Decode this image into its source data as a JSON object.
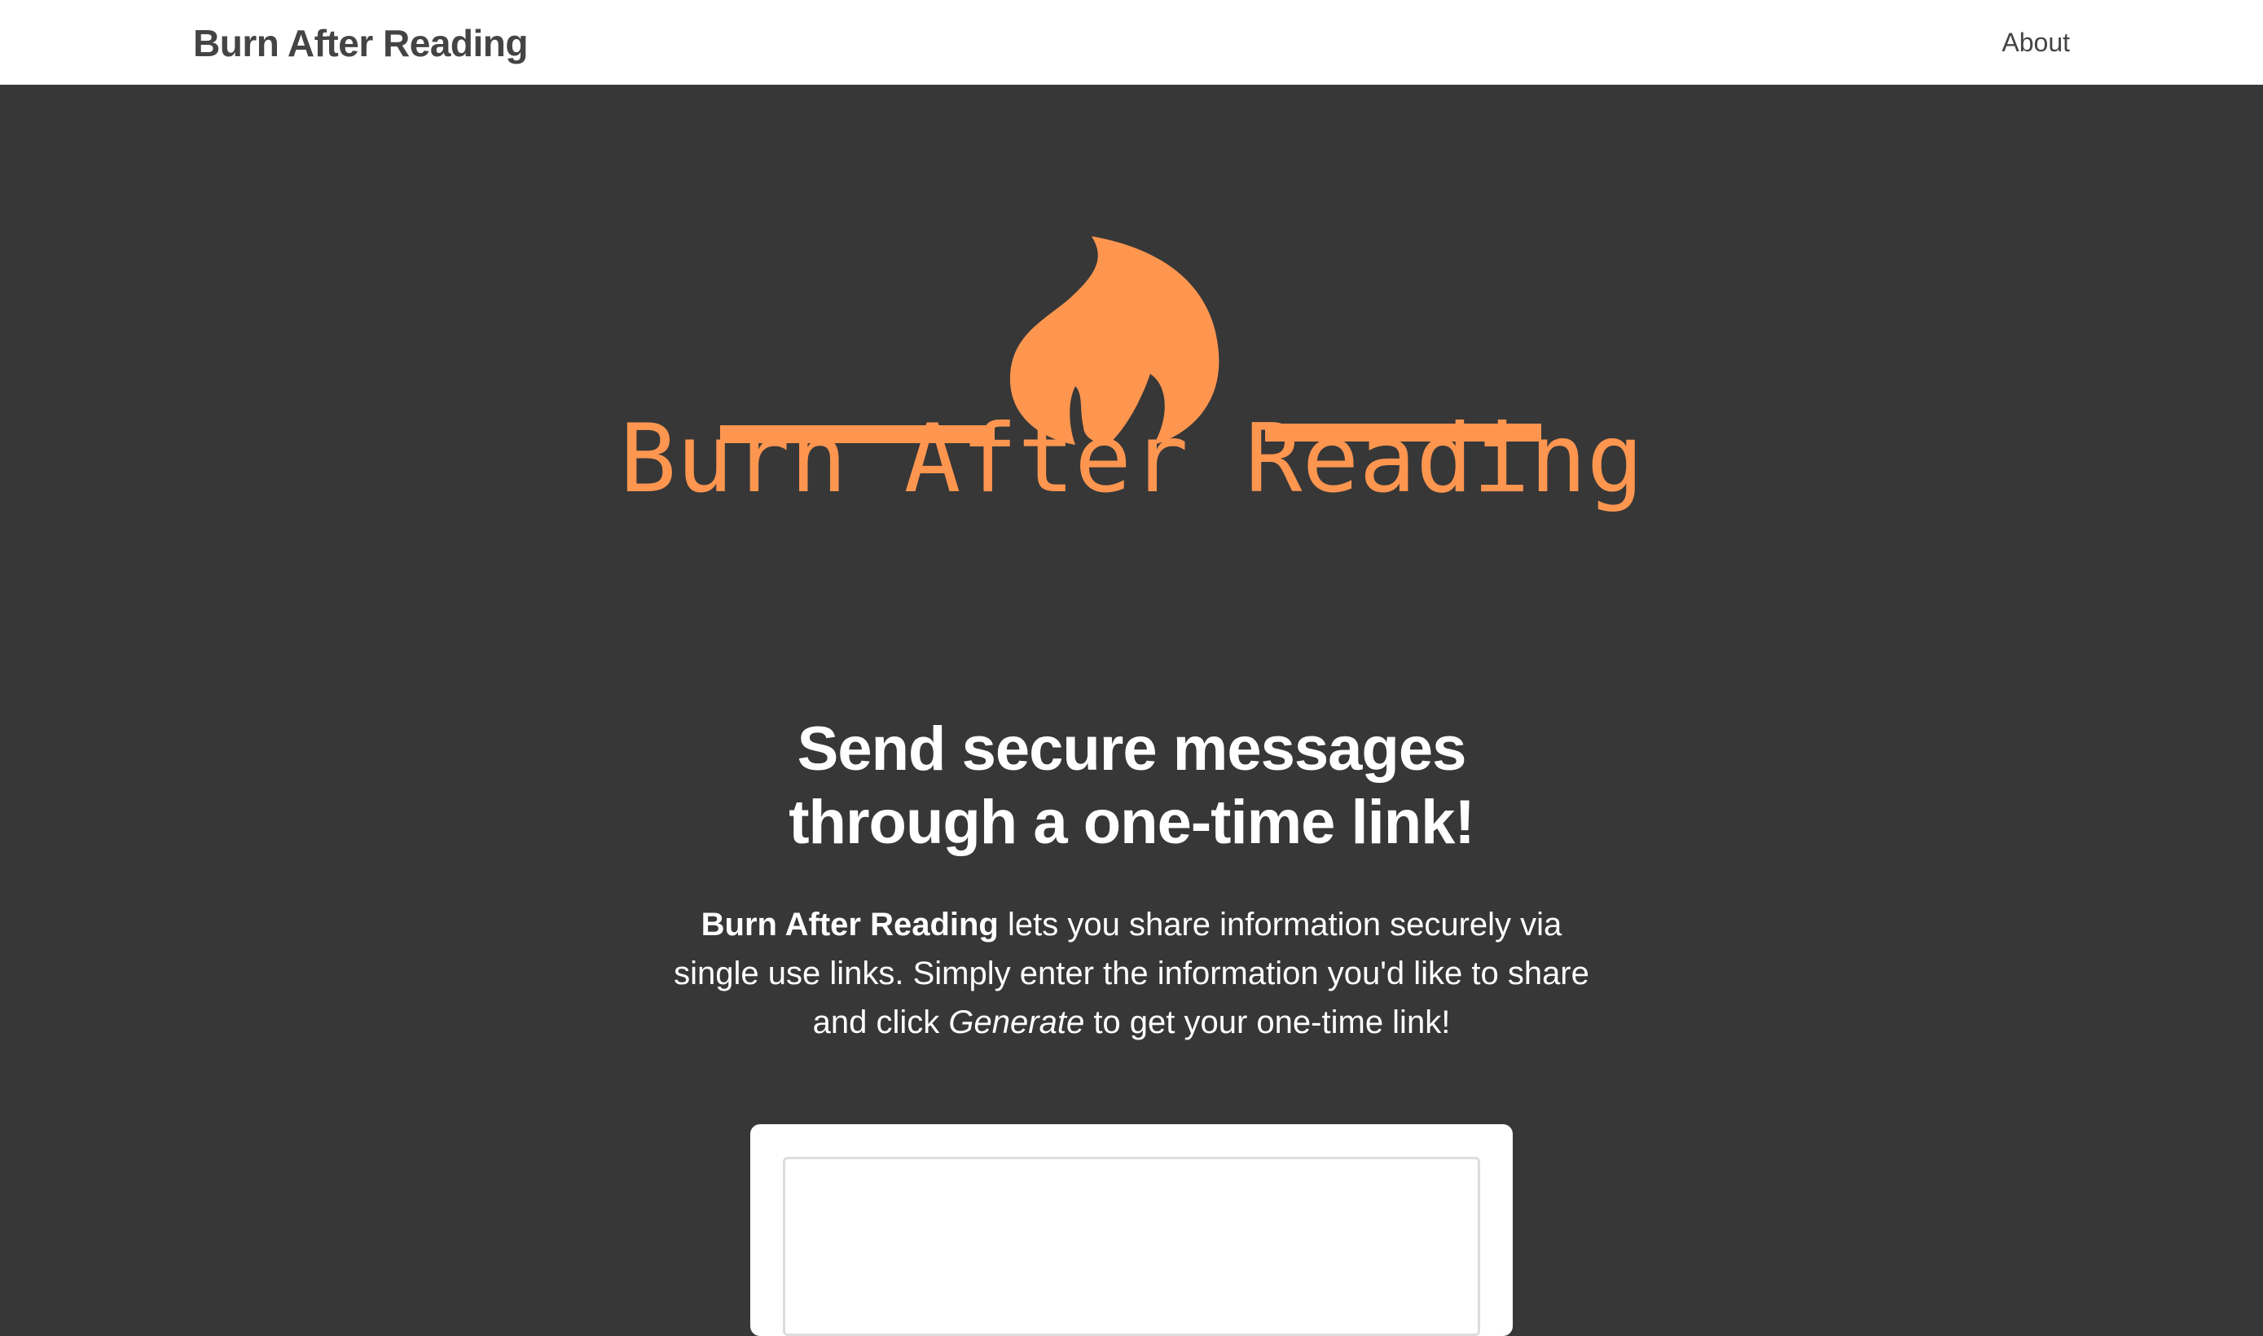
{
  "navbar": {
    "brand": "Burn After Reading",
    "about_link": "About"
  },
  "hero": {
    "logo_icon": "flame-icon",
    "logo_text": "Burn After Reading",
    "accent_color": "#ff9650",
    "background_color": "#373737"
  },
  "headline": {
    "line1": "Send secure messages",
    "line2": "through a one-time link!"
  },
  "intro": {
    "strong": "Burn After Reading",
    "part1": " lets you share information securely via single use links. Simply enter the information you'd like to share and click ",
    "em": "Generate",
    "part2": " to get your one-time link!"
  },
  "form": {
    "message_value": "",
    "message_placeholder": ""
  }
}
